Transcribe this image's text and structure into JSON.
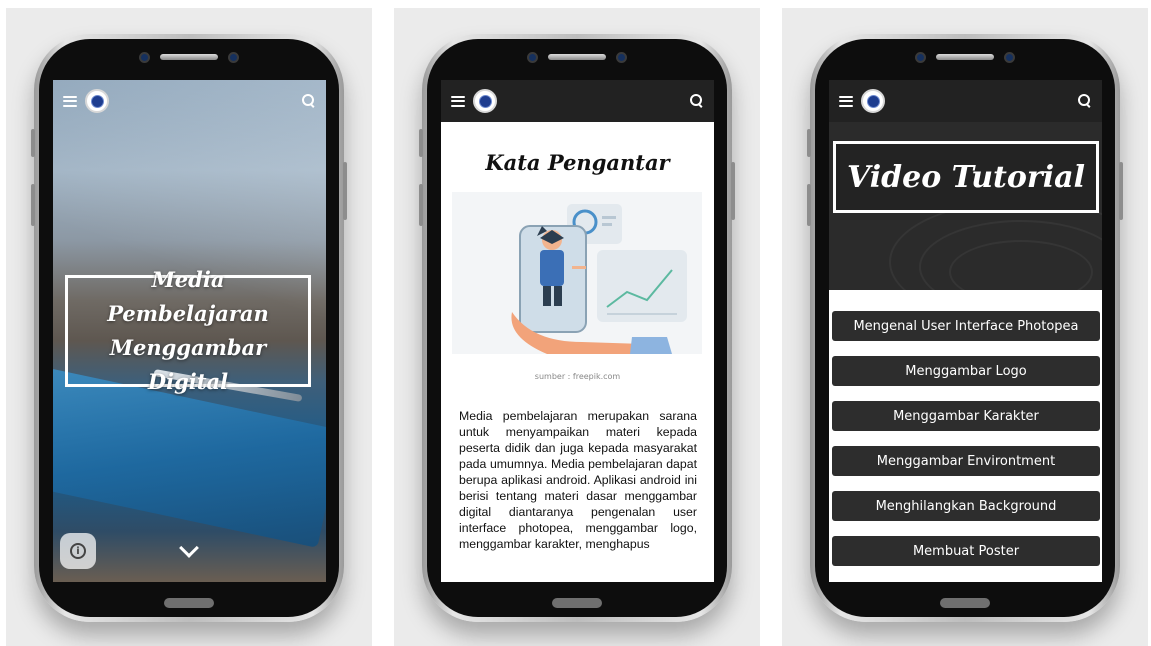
{
  "screen1": {
    "title_line1": "Media Pembelajaran",
    "title_line2": "Menggambar Digital",
    "info_glyph": "i",
    "icons": [
      "menu-icon",
      "logo-icon",
      "search-icon",
      "info-icon",
      "chevron-down-icon"
    ]
  },
  "screen2": {
    "heading": "Kata Pengantar",
    "image_caption": "sumber : freepik.com",
    "body_text": "Media pembelajaran merupakan sarana untuk menyampaikan materi kepada peserta didik dan juga kepada masyarakat pada umumnya. Media pembelajaran dapat berupa aplikasi android. Aplikasi android ini berisi tentang materi dasar menggambar digital diantaranya pengenalan user interface photopea, menggambar logo, menggambar karakter, menghapus"
  },
  "screen3": {
    "heading": "Video Tutorial",
    "items": [
      {
        "label": "Mengenal User Interface Photopea"
      },
      {
        "label": "Menggambar Logo"
      },
      {
        "label": "Menggambar Karakter"
      },
      {
        "label": "Menggambar Environtment"
      },
      {
        "label": "Menghilangkan Background"
      },
      {
        "label": "Membuat Poster"
      }
    ]
  },
  "colors": {
    "app_bar_dark": "#222222",
    "button_dark": "#2d2d2d",
    "logo_blue": "#1e3d8f"
  }
}
